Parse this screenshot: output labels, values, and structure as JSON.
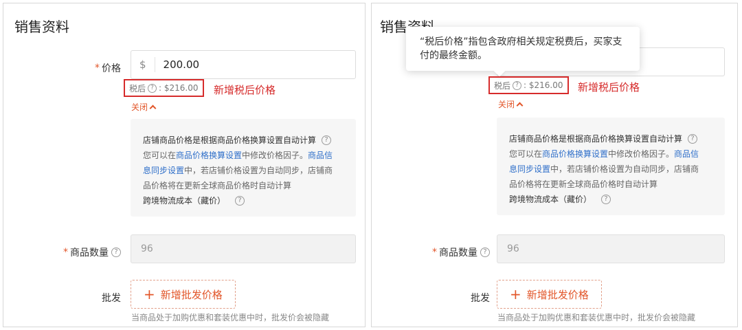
{
  "left": {
    "title": "销售资料",
    "price": {
      "required_mark": "*",
      "label": "价格",
      "currency": "$",
      "value": "200.00"
    },
    "tax": {
      "label": "税后",
      "help": "?",
      "amount": ": $216.00"
    },
    "annotation": "新增税后价格",
    "close_label": "关闭",
    "info": {
      "line1": "店铺商品价格是根据商品价格换算设置自动计算",
      "line2_pre": "您可以在",
      "line2_link": "商品价格换算设置",
      "line2_mid": "中修改价格因子。",
      "line2_link2": "商品信",
      "line3_link": "息同步设置",
      "line3_rest": "中，若店铺价格设置为自动同步，店铺商",
      "line4": "品价格将在更新全球商品价格时自动计算",
      "line5": "跨境物流成本（藏价）"
    },
    "quantity": {
      "required_mark": "*",
      "label": "商品数量",
      "value": "96"
    },
    "wholesale": {
      "label": "批发",
      "button": "新增批发价格",
      "hint": "当商品处于加购优惠和套装优惠中时，批发价会被隐藏"
    }
  },
  "right": {
    "title": "销售资料",
    "tooltip": "“税后价格”指包含政府相关规定税费后，买家支付的最终金额。",
    "tax": {
      "label": "税后",
      "help": "?",
      "amount": ": $216.00"
    },
    "annotation": "新增税后价格",
    "close_label": "关闭",
    "info": {
      "line1": "店铺商品价格是根据商品价格换算设置自动计算",
      "line2_pre": "您可以在",
      "line2_link": "商品价格换算设置",
      "line2_mid": "中修改价格因子。",
      "line2_link2": "商品信",
      "line3_link": "息同步设置",
      "line3_rest": "中，若店铺价格设置为自动同步，店铺商",
      "line4": "品价格将在更新全球商品价格时自动计算",
      "line5": "跨境物流成本（藏价）"
    },
    "quantity": {
      "required_mark": "*",
      "label": "商品数量",
      "value": "96"
    },
    "wholesale": {
      "label": "批发",
      "button": "新增批发价格",
      "hint": "当商品处于加购优惠和套装优惠中时，批发价会被隐藏"
    }
  }
}
